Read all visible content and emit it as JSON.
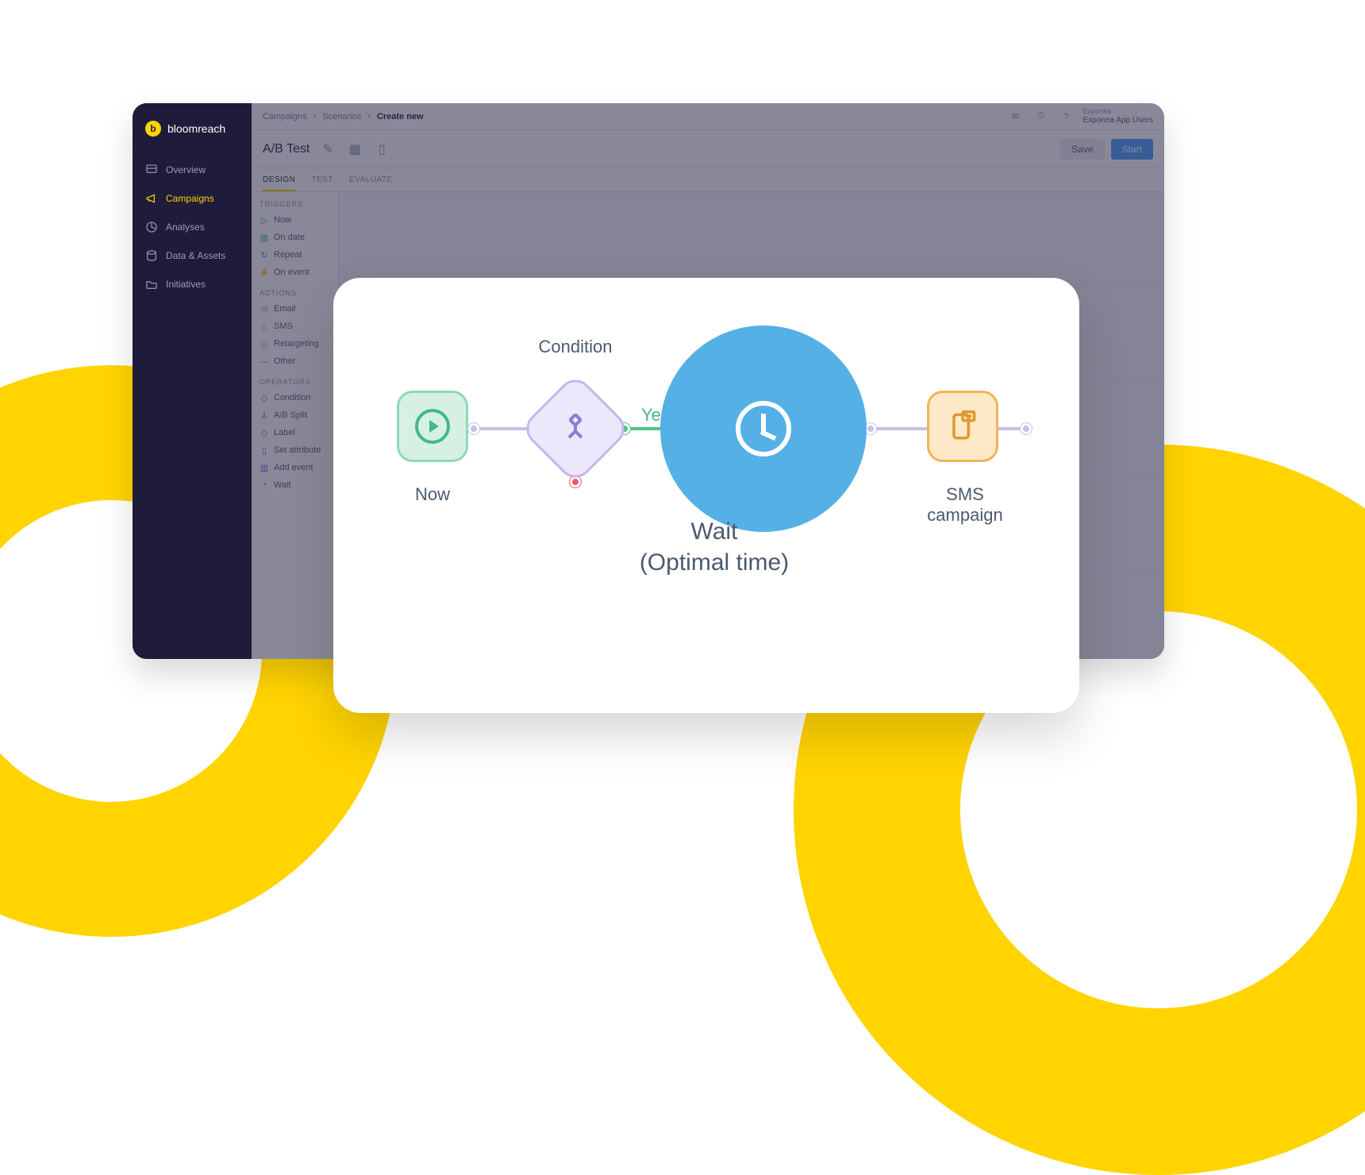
{
  "brand": {
    "name": "bloomreach",
    "initial": "b"
  },
  "sidebar": {
    "items": [
      {
        "label": "Overview",
        "icon": "overview-icon"
      },
      {
        "label": "Campaigns",
        "icon": "megaphone-icon",
        "active": true
      },
      {
        "label": "Analyses",
        "icon": "pie-icon"
      },
      {
        "label": "Data & Assets",
        "icon": "database-icon"
      },
      {
        "label": "Initiatives",
        "icon": "folder-icon"
      }
    ]
  },
  "header": {
    "breadcrumb": [
      "Campaigns",
      "Scenarios",
      "Create new"
    ],
    "doc_title": "A/B Test",
    "save_label": "Save",
    "start_label": "Start",
    "project_caption": "Exponea",
    "project_name": "Exponea App Users"
  },
  "tabs": [
    {
      "label": "DESIGN",
      "active": true
    },
    {
      "label": "TEST"
    },
    {
      "label": "EVALUATE"
    }
  ],
  "palette": {
    "sections": [
      {
        "header": "TRIGGERS",
        "items": [
          "Now",
          "On date",
          "Repeat",
          "On event"
        ]
      },
      {
        "header": "ACTIONS",
        "items": [
          "Email",
          "SMS",
          "Retargeting",
          "Other"
        ]
      },
      {
        "header": "OPERATORS",
        "items": [
          "Condition",
          "A/B Split",
          "Label",
          "Set attribute",
          "Add event",
          "Wait"
        ]
      }
    ]
  },
  "flow": {
    "now": "Now",
    "condition": "Condition",
    "yes": "Yes",
    "wait_line1": "Wait",
    "wait_line2": "(Optimal time)",
    "sms_line1": "SMS",
    "sms_line2": "campaign"
  }
}
